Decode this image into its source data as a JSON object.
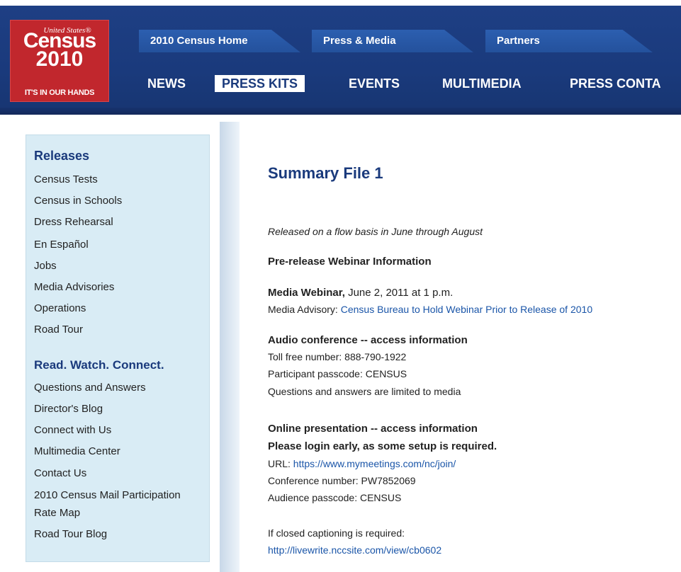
{
  "logo": {
    "top": "United States®",
    "brand": "Census",
    "year": "2010",
    "tagline": "IT'S IN OUR HANDS"
  },
  "tabs": [
    {
      "label": "2010 Census Home"
    },
    {
      "label": "Press & Media"
    },
    {
      "label": "Partners"
    }
  ],
  "nav": [
    {
      "label": "NEWS"
    },
    {
      "label": "PRESS KITS"
    },
    {
      "label": "EVENTS"
    },
    {
      "label": "MULTIMEDIA"
    },
    {
      "label": "PRESS CONTA"
    }
  ],
  "sidebar": {
    "releases_heading": "Releases",
    "releases": [
      "Census Tests",
      "Census in Schools",
      "Dress Rehearsal",
      "En Español",
      "Jobs",
      "Media Advisories",
      "Operations",
      "Road Tour"
    ],
    "connect_heading": "Read. Watch. Connect.",
    "connect": [
      "Questions and Answers",
      "Director's Blog",
      "Connect with Us",
      "Multimedia Center",
      "Contact Us",
      "2010 Census Mail Participation",
      "Rate Map",
      "Road Tour Blog"
    ]
  },
  "main": {
    "title": "Summary File 1",
    "released": "Released on a flow basis in June through August",
    "prerelease": "Pre-release Webinar Information",
    "webinar_label": "Media Webinar,",
    "webinar_date": " June 2, 2011 at 1 p.m.",
    "advisory_label": "Media Advisory: ",
    "advisory_link": "Census Bureau to Hold Webinar Prior to Release of 2010",
    "audio_heading": "Audio conference -- access information",
    "toll_free": "Toll free number: 888-790-1922",
    "participant": "Participant passcode: CENSUS",
    "limited": "Questions and answers are limited to media",
    "online_heading": "Online presentation -- access information",
    "login_early": "Please login early, as some setup is required.",
    "url_label": "URL: ",
    "url_link": "https://www.mymeetings.com/nc/join/",
    "conference": "Conference number: PW7852069",
    "audience": "Audience passcode: CENSUS",
    "captioning": "If closed captioning is required:",
    "caption_link": "http://livewrite.nccsite.com/view/cb0602"
  }
}
